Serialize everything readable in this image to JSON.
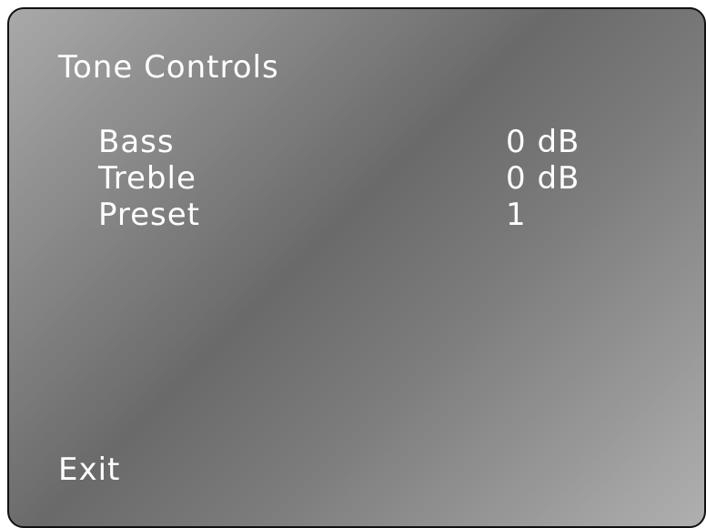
{
  "menu_title": "Tone Controls",
  "items": [
    {
      "label": "Bass",
      "value": "0 dB"
    },
    {
      "label": "Treble",
      "value": "0 dB"
    },
    {
      "label": "Preset",
      "value": "1"
    }
  ],
  "exit_label": "Exit",
  "colors": {
    "text": "#ffffff",
    "border": "#111111",
    "panel_dark": "#6a6a6a",
    "panel_light": "#b0b0b0"
  }
}
